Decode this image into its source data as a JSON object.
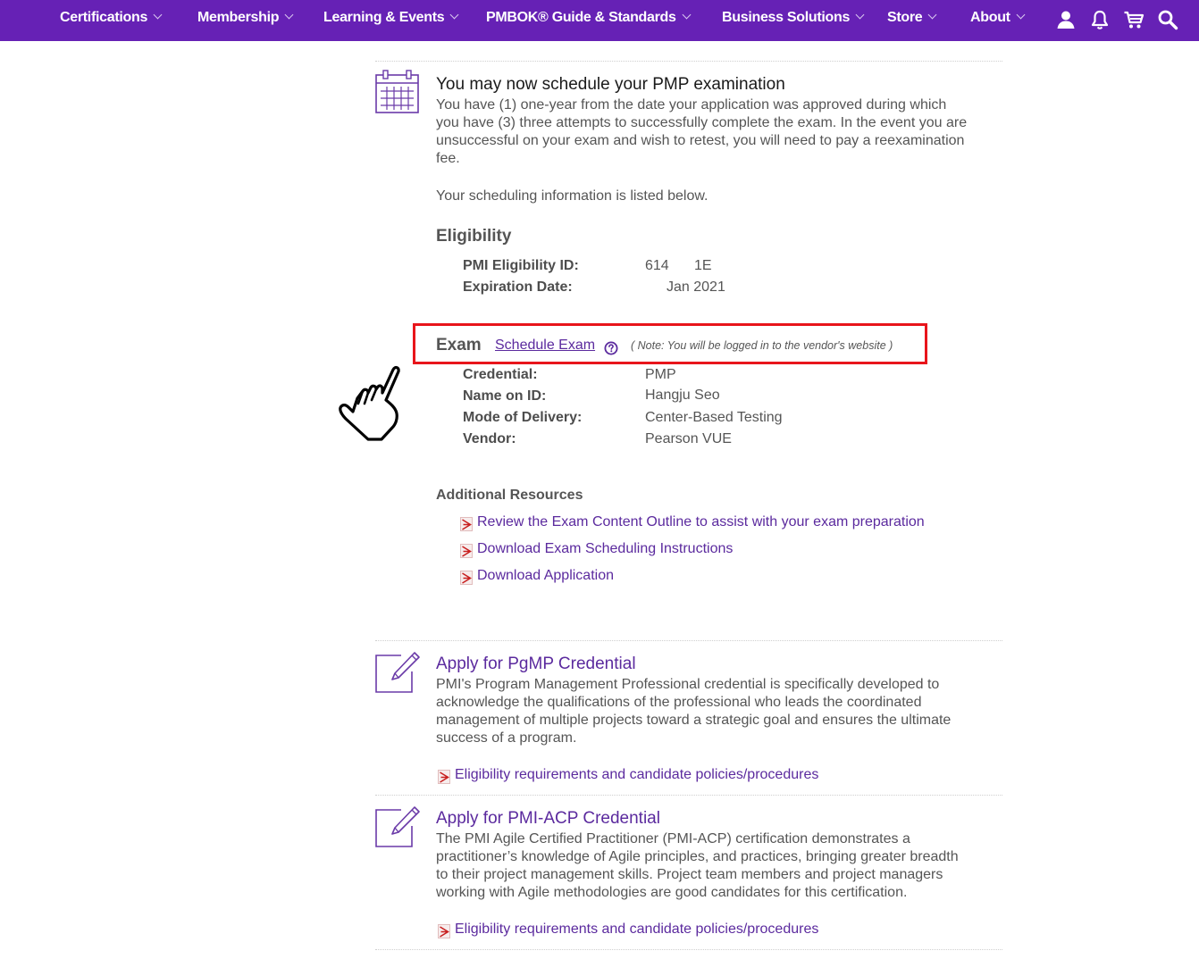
{
  "nav": {
    "items": [
      {
        "label": "Certifications"
      },
      {
        "label": "Membership"
      },
      {
        "label": "Learning & Events"
      },
      {
        "label": "PMBOK® Guide & Standards"
      },
      {
        "label": "Business Solutions"
      },
      {
        "label": "Store"
      },
      {
        "label": "About"
      }
    ],
    "icons": [
      "user-icon",
      "bell-icon",
      "cart-icon",
      "search-icon"
    ],
    "bg_color": "#6621b5"
  },
  "pmp": {
    "title": "You may now schedule your PMP examination",
    "desc_lines": [
      "You have (1) one-year from the date your application was approved during which",
      "you have (3) three attempts to successfully complete the exam. In the event you are",
      "unsuccessful on your exam and wish to retest, you will need to pay a reexamination",
      "fee."
    ],
    "sched_info": "Your scheduling information is listed below.",
    "eligibility": {
      "heading": "Eligibility",
      "id_label": "PMI Eligibility ID:",
      "id_part1": "614",
      "id_part2": "1E",
      "exp_label": "Expiration Date:",
      "exp_value": "Jan 2021"
    },
    "exam": {
      "heading": "Exam",
      "schedule_link": "Schedule Exam",
      "note": "( Note: You will be logged in to the vendor's website )",
      "credential_label": "Credential:",
      "credential_value": "PMP",
      "name_label": "Name on ID:",
      "name_value": "Hangju Seo",
      "mode_label": "Mode of Delivery:",
      "mode_value": "Center-Based Testing",
      "vendor_label": "Vendor:",
      "vendor_value": "Pearson VUE"
    },
    "resources": {
      "heading": "Additional Resources",
      "links": [
        "Review the Exam Content Outline to assist with your exam preparation",
        "Download Exam Scheduling Instructions",
        "Download Application"
      ]
    }
  },
  "pgmp": {
    "title": "Apply for PgMP Credential",
    "desc_lines": [
      "PMI's Program Management Professional credential is specifically developed to",
      "acknowledge the qualifications of the professional who leads the coordinated",
      "management of multiple projects toward a strategic goal and ensures the ultimate",
      "success of a program."
    ],
    "link": "Eligibility requirements and candidate policies/procedures"
  },
  "acp": {
    "title": "Apply for PMI-ACP Credential",
    "desc_lines": [
      "The PMI Agile Certified Practitioner (PMI-ACP) certification demonstrates a",
      "practitioner’s knowledge of Agile principles, and practices, bringing greater breadth",
      "to their project management skills. Project team members and project managers",
      "working with Agile methodologies are good candidates for this certification."
    ],
    "link": "Eligibility requirements and candidate policies/procedures"
  },
  "colors": {
    "accent": "#5b2a9e",
    "highlight": "#e8151b"
  }
}
